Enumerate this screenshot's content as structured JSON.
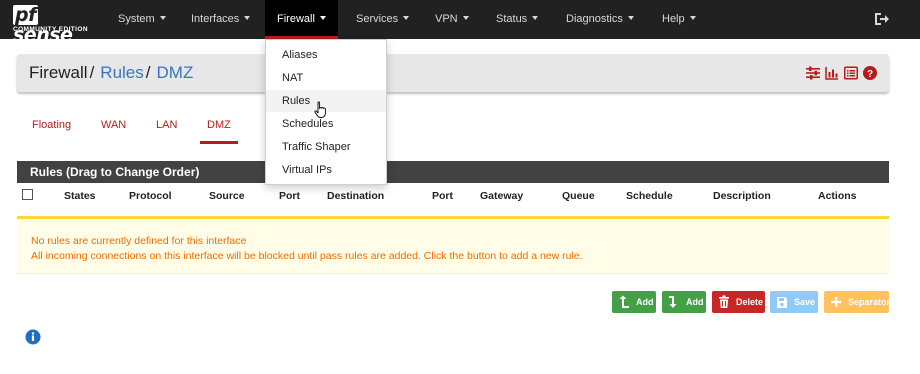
{
  "brand": {
    "name": "pfsense",
    "name_prefix": "pf",
    "name_rest": "sense",
    "edition": "COMMUNITY EDITION"
  },
  "nav": {
    "items": [
      {
        "label": "System"
      },
      {
        "label": "Interfaces"
      },
      {
        "label": "Firewall"
      },
      {
        "label": "Services"
      },
      {
        "label": "VPN"
      },
      {
        "label": "Status"
      },
      {
        "label": "Diagnostics"
      },
      {
        "label": "Help"
      }
    ],
    "active": "Firewall",
    "logout_icon": "sign-out-icon"
  },
  "firewall_menu": {
    "items": [
      {
        "label": "Aliases"
      },
      {
        "label": "NAT"
      },
      {
        "label": "Rules"
      },
      {
        "label": "Schedules"
      },
      {
        "label": "Traffic Shaper"
      },
      {
        "label": "Virtual IPs"
      }
    ],
    "hovered": "Rules"
  },
  "breadcrumb": {
    "root": "Firewall",
    "section": "Rules",
    "current": "DMZ",
    "separator": "/"
  },
  "toolbar_icons": [
    "sliders-icon",
    "bar-chart-icon",
    "list-icon",
    "help-icon"
  ],
  "tabs": {
    "items": [
      {
        "label": "Floating"
      },
      {
        "label": "WAN"
      },
      {
        "label": "LAN"
      },
      {
        "label": "DMZ"
      }
    ],
    "active": "DMZ"
  },
  "rules_panel": {
    "title": "Rules (Drag to Change Order)",
    "columns": [
      "States",
      "Protocol",
      "Source",
      "Port",
      "Destination",
      "Port",
      "Gateway",
      "Queue",
      "Schedule",
      "Description",
      "Actions"
    ],
    "empty_line1": "No rules are currently defined for this interface",
    "empty_line2": "All incoming connections on this interface will be blocked until pass rules are added. Click the button to add a new rule."
  },
  "actions": {
    "add_top": "Add",
    "add_bottom": "Add",
    "delete": "Delete",
    "save": "Save",
    "separator": "Separator"
  },
  "colors": {
    "navbar": "#212121",
    "accent": "#b71c1c",
    "link": "#3c73c0",
    "warning_text": "#ef6c00",
    "btn_add": "#43a047",
    "btn_delete": "#c62828",
    "btn_save": "#90caf9",
    "btn_separator": "#ffc25c"
  }
}
